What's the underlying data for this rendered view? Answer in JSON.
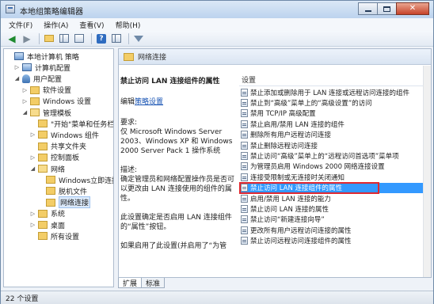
{
  "window": {
    "title": "本地组策略编辑器"
  },
  "menu": [
    "文件(F)",
    "操作(A)",
    "查看(V)",
    "帮助(H)"
  ],
  "tree": [
    {
      "label": "本地计算机 策略",
      "indent": 0,
      "icon": "policy-icon",
      "exp": ""
    },
    {
      "label": "计算机配置",
      "indent": 1,
      "icon": "computer-icon",
      "exp": "▷"
    },
    {
      "label": "用户配置",
      "indent": 1,
      "icon": "user-icon",
      "exp": "◢"
    },
    {
      "label": "软件设置",
      "indent": 2,
      "icon": "folder-icon",
      "exp": "▷"
    },
    {
      "label": "Windows 设置",
      "indent": 2,
      "icon": "folder-icon",
      "exp": "▷"
    },
    {
      "label": "管理模板",
      "indent": 2,
      "icon": "folder-open-icon",
      "exp": "◢"
    },
    {
      "label": "\"开始\"菜单和任务栏",
      "indent": 3,
      "icon": "folder-icon",
      "exp": ""
    },
    {
      "label": "Windows 组件",
      "indent": 3,
      "icon": "folder-icon",
      "exp": "▷"
    },
    {
      "label": "共享文件夹",
      "indent": 3,
      "icon": "folder-icon",
      "exp": ""
    },
    {
      "label": "控制面板",
      "indent": 3,
      "icon": "folder-icon",
      "exp": "▷"
    },
    {
      "label": "网络",
      "indent": 3,
      "icon": "folder-open-icon",
      "exp": "◢"
    },
    {
      "label": "Windows立即连接",
      "indent": 4,
      "icon": "folder-icon",
      "exp": ""
    },
    {
      "label": "脱机文件",
      "indent": 4,
      "icon": "folder-icon",
      "exp": ""
    },
    {
      "label": "网络连接",
      "indent": 4,
      "icon": "folder-icon",
      "exp": "",
      "selected": true
    },
    {
      "label": "系统",
      "indent": 3,
      "icon": "folder-icon",
      "exp": "▷"
    },
    {
      "label": "桌面",
      "indent": 3,
      "icon": "folder-icon",
      "exp": "▷"
    },
    {
      "label": "所有设置",
      "indent": 3,
      "icon": "folder-icon",
      "exp": ""
    }
  ],
  "right": {
    "header": "网络连接",
    "desc": {
      "title": "禁止访问 LAN 连接组件的属性",
      "edit_prefix": "编辑",
      "edit_link": "策略设置",
      "req_label": "要求:",
      "req_text": "仅 Microsoft Windows Server 2003、Windows XP 和 Windows 2000 Server Pack 1 操作系统",
      "desc_label": "描述:",
      "desc_text": "确定管理员和网络配置操作员是否可以更改由 LAN 连接使用的组件的属性。",
      "desc_text2": "此设置确定是否启用 LAN 连接组件的“属性”按钮。",
      "desc_text3": "如果启用了此设置(并启用了“为管"
    },
    "settings_header": "设置",
    "settings": [
      "禁止添加或删除用于 LAN 连接或远程访问连接的组件",
      "禁止到“高级”菜单上的“高级设置”的访问",
      "禁用 TCP/IP 高级配置",
      "禁止启用/禁用 LAN 连接的组件",
      "删除所有用户远程访问连接",
      "禁止删除远程访问连接",
      "禁止访问“高级”菜单上的“远程访问首选项”菜单项",
      "为管理员启用 Windows 2000 网络连接设置",
      "连接受限制或无连接时关闭通知",
      "禁止访问 LAN 连接组件的属性",
      "启用/禁用 LAN 连接的能力",
      "禁止访问 LAN 连接的属性",
      "禁止访问“新建连接向导”",
      "更改所有用户远程访问连接的属性",
      "禁止访问远程访问连接组件的属性"
    ],
    "selected_index": 9
  },
  "tabs": [
    "扩展",
    "标准"
  ],
  "active_tab": 0,
  "status": "22 个设置"
}
